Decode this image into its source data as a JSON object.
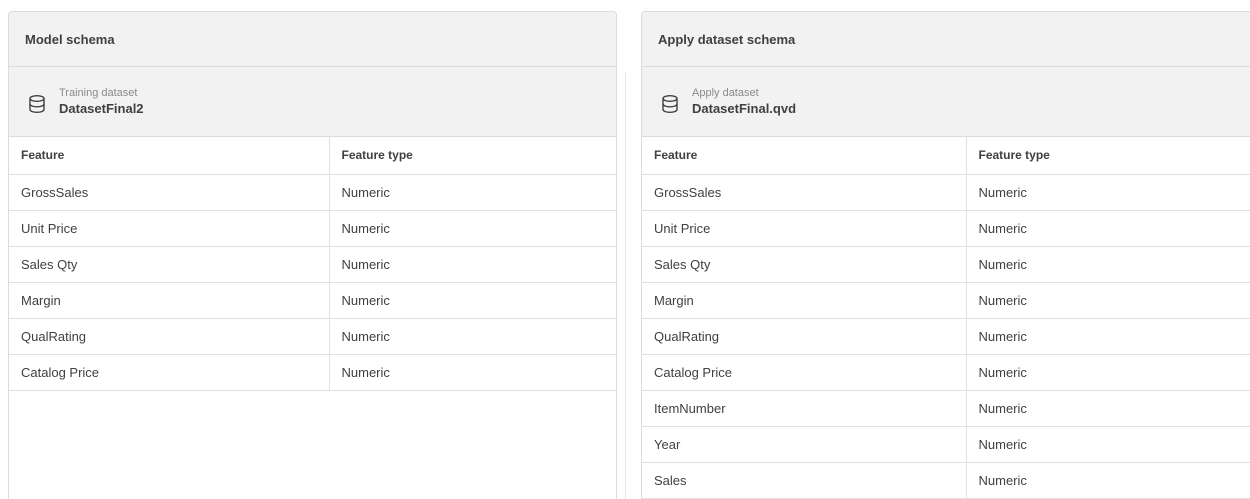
{
  "left": {
    "title": "Model schema",
    "dataset_caption": "Training dataset",
    "dataset_name": "DatasetFinal2",
    "columns": [
      "Feature",
      "Feature type"
    ],
    "rows": [
      [
        "GrossSales",
        "Numeric"
      ],
      [
        "Unit Price",
        "Numeric"
      ],
      [
        "Sales Qty",
        "Numeric"
      ],
      [
        "Margin",
        "Numeric"
      ],
      [
        "QualRating",
        "Numeric"
      ],
      [
        "Catalog Price",
        "Numeric"
      ]
    ]
  },
  "right": {
    "title": "Apply dataset schema",
    "dataset_caption": "Apply dataset",
    "dataset_name": "DatasetFinal.qvd",
    "columns": [
      "Feature",
      "Feature type"
    ],
    "rows": [
      [
        "GrossSales",
        "Numeric"
      ],
      [
        "Unit Price",
        "Numeric"
      ],
      [
        "Sales Qty",
        "Numeric"
      ],
      [
        "Margin",
        "Numeric"
      ],
      [
        "QualRating",
        "Numeric"
      ],
      [
        "Catalog Price",
        "Numeric"
      ],
      [
        "ItemNumber",
        "Numeric"
      ],
      [
        "Year",
        "Numeric"
      ],
      [
        "Sales",
        "Numeric"
      ]
    ]
  },
  "icons": {
    "dataset": "database-icon"
  }
}
